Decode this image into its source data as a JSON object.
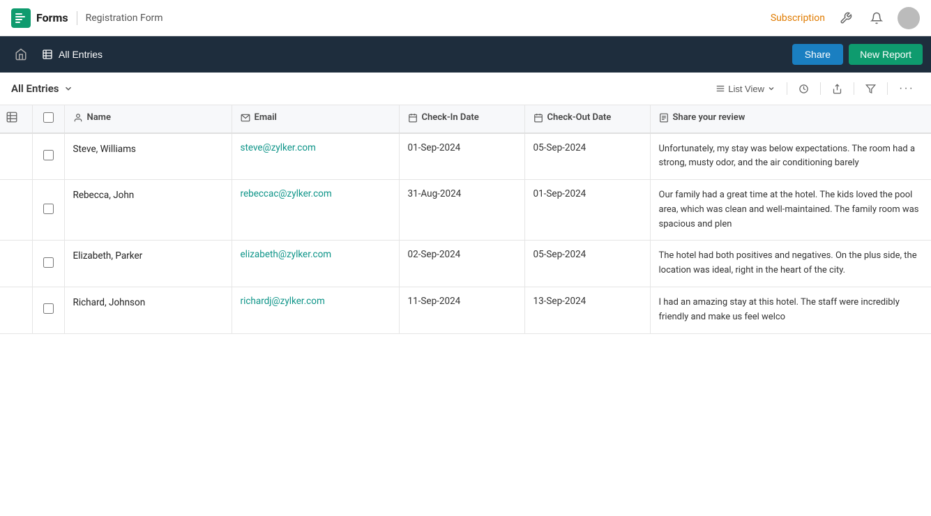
{
  "app": {
    "logo_text": "Forms",
    "breadcrumb": "Registration Form",
    "subscription_label": "Subscription",
    "nav_icons": {
      "tools": "⚙",
      "bell": "🔔"
    }
  },
  "secondary_nav": {
    "home_icon": "🏠",
    "entries_icon": "📋",
    "all_entries_label": "All Entries",
    "share_label": "Share",
    "new_report_label": "New Report"
  },
  "toolbar": {
    "all_entries_label": "All Entries",
    "list_view_label": "List View",
    "history_icon": "🕐",
    "export_icon": "⬆",
    "filter_icon": "⊞",
    "more_icon": "···"
  },
  "table": {
    "columns": [
      {
        "id": "expand",
        "label": ""
      },
      {
        "id": "check",
        "label": ""
      },
      {
        "id": "name",
        "label": "Name",
        "icon": "person"
      },
      {
        "id": "email",
        "label": "Email",
        "icon": "email"
      },
      {
        "id": "checkin",
        "label": "Check-In Date",
        "icon": "calendar"
      },
      {
        "id": "checkout",
        "label": "Check-Out Date",
        "icon": "calendar"
      },
      {
        "id": "review",
        "label": "Share your review",
        "icon": "doc"
      }
    ],
    "rows": [
      {
        "id": 1,
        "name": "Steve, Williams",
        "email": "steve@zylker.com",
        "checkin": "01-Sep-2024",
        "checkout": "05-Sep-2024",
        "review": "Unfortunately, my stay was below expectations. The room had a strong, musty odor, and the air conditioning barely"
      },
      {
        "id": 2,
        "name": "Rebecca, John",
        "email": "rebeccac@zylker.com",
        "checkin": "31-Aug-2024",
        "checkout": "01-Sep-2024",
        "review": "Our family had a great time at the hotel. The kids loved the pool area, which was clean and well-maintained. The family room was spacious and plen"
      },
      {
        "id": 3,
        "name": "Elizabeth, Parker",
        "email": "elizabeth@zylker.com",
        "checkin": "02-Sep-2024",
        "checkout": "05-Sep-2024",
        "review": "The hotel had both positives and negatives. On the plus side, the location was ideal, right in the heart of the city."
      },
      {
        "id": 4,
        "name": "Richard, Johnson",
        "email": "richardj@zylker.com",
        "checkin": "11-Sep-2024",
        "checkout": "13-Sep-2024",
        "review": "I had an amazing stay at this hotel. The staff were incredibly friendly and make us feel welco"
      }
    ]
  }
}
